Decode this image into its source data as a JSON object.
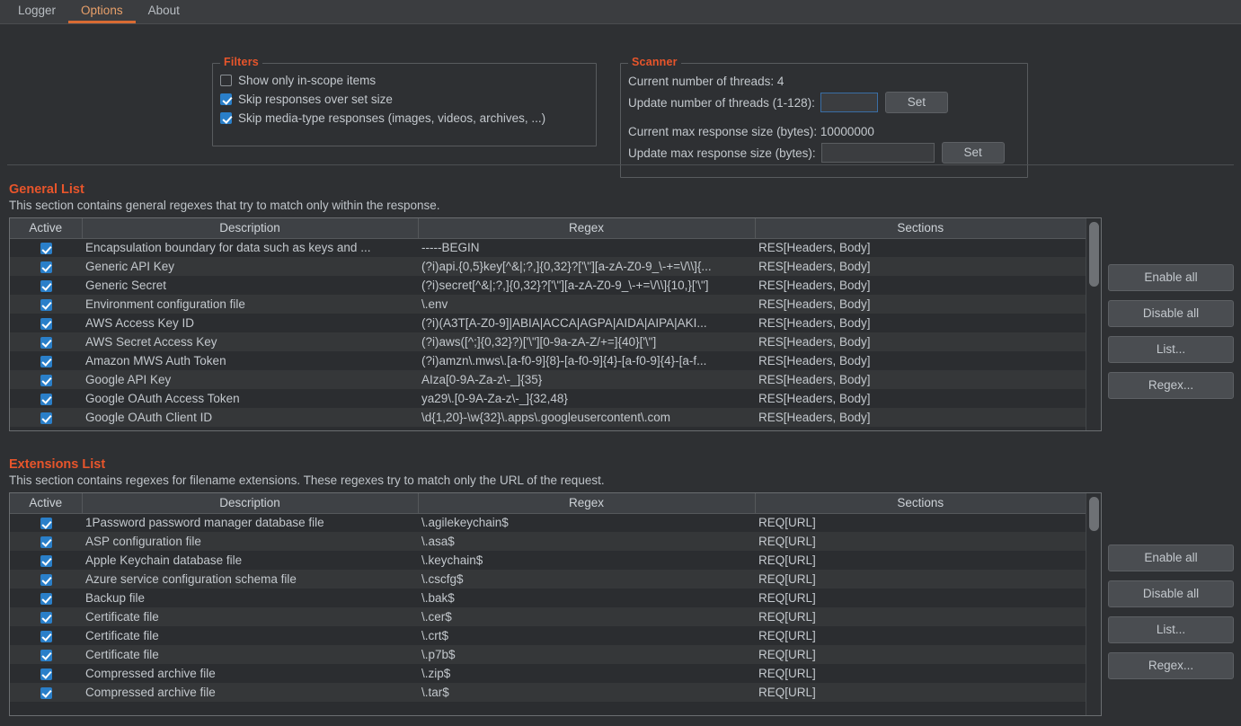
{
  "tabs": [
    {
      "label": "Logger",
      "active": false
    },
    {
      "label": "Options",
      "active": true
    },
    {
      "label": "About",
      "active": false
    }
  ],
  "filters": {
    "title": "Filters",
    "options": [
      {
        "label": "Show only in-scope items",
        "checked": false
      },
      {
        "label": "Skip responses over set size",
        "checked": true
      },
      {
        "label": "Skip media-type responses (images, videos, archives, ...)",
        "checked": true
      }
    ]
  },
  "scanner": {
    "title": "Scanner",
    "current_threads_label": "Current number of threads: 4",
    "update_threads_label": "Update number of threads (1-128):",
    "update_threads_value": "",
    "update_threads_set_label": "Set",
    "current_max_response_label": "Current max response size (bytes): 10000000",
    "update_max_response_label": "Update max response size (bytes):",
    "update_max_response_value": "",
    "update_max_response_set_label": "Set"
  },
  "general_list": {
    "title": "General List",
    "description": "This section contains general regexes that try to match only within the response.",
    "columns": [
      "Active",
      "Description",
      "Regex",
      "Sections"
    ],
    "rows": [
      {
        "active": true,
        "description": "Encapsulation boundary for data such as keys and ...",
        "regex": "-----BEGIN",
        "sections": "RES[Headers, Body]"
      },
      {
        "active": true,
        "description": "Generic API Key",
        "regex": "(?i)api.{0,5}key[^&|;?,]{0,32}?['\\\"][a-zA-Z0-9_\\-+=\\/\\\\]{...",
        "sections": "RES[Headers, Body]"
      },
      {
        "active": true,
        "description": "Generic Secret",
        "regex": "(?i)secret[^&|;?,]{0,32}?['\\\"][a-zA-Z0-9_\\-+=\\/\\\\]{10,}['\\\"]",
        "sections": "RES[Headers, Body]"
      },
      {
        "active": true,
        "description": "Environment configuration file",
        "regex": "\\.env",
        "sections": "RES[Headers, Body]"
      },
      {
        "active": true,
        "description": "AWS Access Key ID",
        "regex": "(?i)(A3T[A-Z0-9]|ABIA|ACCA|AGPA|AIDA|AIPA|AKI...",
        "sections": "RES[Headers, Body]"
      },
      {
        "active": true,
        "description": "AWS Secret Access Key",
        "regex": "(?i)aws([^;]{0,32}?)['\\\"][0-9a-zA-Z/+=]{40}['\\\"]",
        "sections": "RES[Headers, Body]"
      },
      {
        "active": true,
        "description": "Amazon MWS Auth Token",
        "regex": "(?i)amzn\\.mws\\.[a-f0-9]{8}-[a-f0-9]{4}-[a-f0-9]{4}-[a-f...",
        "sections": "RES[Headers, Body]"
      },
      {
        "active": true,
        "description": "Google API Key",
        "regex": "AIza[0-9A-Za-z\\-_]{35}",
        "sections": "RES[Headers, Body]"
      },
      {
        "active": true,
        "description": "Google OAuth Access Token",
        "regex": "ya29\\.[0-9A-Za-z\\-_]{32,48}",
        "sections": "RES[Headers, Body]"
      },
      {
        "active": true,
        "description": "Google OAuth Client ID",
        "regex": "\\d{1,20}-\\w{32}\\.apps\\.googleusercontent\\.com",
        "sections": "RES[Headers, Body]"
      }
    ],
    "buttons": [
      "Enable all",
      "Disable all",
      "List...",
      "Regex..."
    ]
  },
  "extensions_list": {
    "title": "Extensions List",
    "description": "This section contains regexes for filename extensions. These regexes try to match only the URL of the request.",
    "columns": [
      "Active",
      "Description",
      "Regex",
      "Sections"
    ],
    "rows": [
      {
        "active": true,
        "description": "1Password password manager database file",
        "regex": "\\.agilekeychain$",
        "sections": "REQ[URL]"
      },
      {
        "active": true,
        "description": "ASP configuration file",
        "regex": "\\.asa$",
        "sections": "REQ[URL]"
      },
      {
        "active": true,
        "description": "Apple Keychain database file",
        "regex": "\\.keychain$",
        "sections": "REQ[URL]"
      },
      {
        "active": true,
        "description": "Azure service configuration schema file",
        "regex": "\\.cscfg$",
        "sections": "REQ[URL]"
      },
      {
        "active": true,
        "description": "Backup file",
        "regex": "\\.bak$",
        "sections": "REQ[URL]"
      },
      {
        "active": true,
        "description": "Certificate file",
        "regex": "\\.cer$",
        "sections": "REQ[URL]"
      },
      {
        "active": true,
        "description": "Certificate file",
        "regex": "\\.crt$",
        "sections": "REQ[URL]"
      },
      {
        "active": true,
        "description": "Certificate file",
        "regex": "\\.p7b$",
        "sections": "REQ[URL]"
      },
      {
        "active": true,
        "description": "Compressed archive file",
        "regex": "\\.zip$",
        "sections": "REQ[URL]"
      },
      {
        "active": true,
        "description": "Compressed archive file",
        "regex": "\\.tar$",
        "sections": "REQ[URL]"
      }
    ],
    "buttons": [
      "Enable all",
      "Disable all",
      "List...",
      "Regex..."
    ]
  },
  "colors": {
    "background": "#2e3033",
    "accent_orange": "#e8552b",
    "tab_active_underline": "#d96b33",
    "checkbox_blue": "#2a7fc9",
    "text": "#bfc4c9"
  }
}
